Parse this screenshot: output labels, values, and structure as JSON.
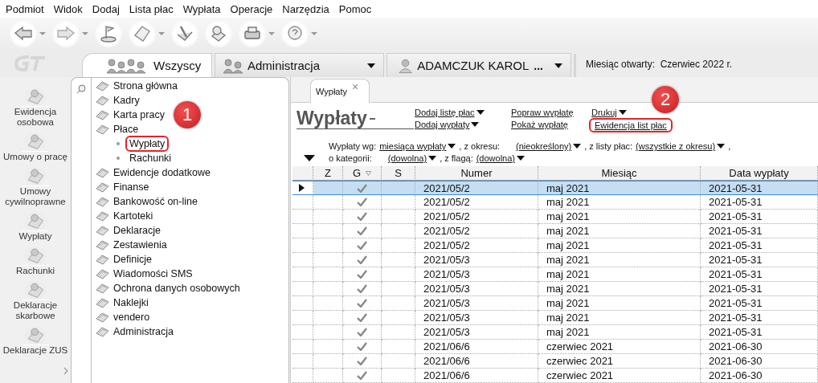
{
  "menu_bar": [
    "Podmiot",
    "Widok",
    "Dodaj",
    "Lista płac",
    "Wypłata",
    "Operacje",
    "Narzędzia",
    "Pomoc"
  ],
  "toolbar": [
    {
      "kind": "back",
      "has_menu": true
    },
    {
      "kind": "forward",
      "has_menu": true
    },
    {
      "kind": "flag",
      "has_menu": false
    },
    {
      "kind": "page",
      "has_menu": true
    },
    {
      "kind": "pen",
      "has_menu": false
    },
    {
      "kind": "magnifier",
      "has_menu": false
    },
    {
      "kind": "printer",
      "has_menu": true
    },
    {
      "kind": "help",
      "has_menu": true
    }
  ],
  "context_tabs": [
    {
      "label": "Wszyscy",
      "kind": "group",
      "selected": true,
      "has_menu": false
    },
    {
      "label": "Administracja",
      "kind": "group",
      "selected": false,
      "has_menu": true
    },
    {
      "label": "ADAMCZUK KAROL",
      "kind": "person",
      "selected": false,
      "has_menu": true,
      "more": "..."
    }
  ],
  "open_month": {
    "label": "Miesiąc otwarty:",
    "value": "Czerwiec 2022 r."
  },
  "nav": [
    "Ewidencja osobowa",
    "Umowy o pracę",
    "Umowy cywilnoprawne",
    "Wypłaty",
    "Rachunki",
    "Deklaracje skarbowe",
    "Deklaracje ZUS"
  ],
  "tree": [
    {
      "label": "Strona główna"
    },
    {
      "label": "Kadry"
    },
    {
      "label": "Karta pracy"
    },
    {
      "label": "Płace",
      "children": [
        {
          "label": "Wypłaty",
          "callout": "1"
        },
        {
          "label": "Rachunki"
        }
      ]
    },
    {
      "label": "Ewidencje dodatkowe"
    },
    {
      "label": "Finanse"
    },
    {
      "label": "Bankowość on-line"
    },
    {
      "label": "Kartoteki"
    },
    {
      "label": "Deklaracje"
    },
    {
      "label": "Zestawienia"
    },
    {
      "label": "Definicje"
    },
    {
      "label": "Wiadomości SMS"
    },
    {
      "label": "Ochrona danych osobowych"
    },
    {
      "label": "Naklejki"
    },
    {
      "label": "vendero"
    },
    {
      "label": "Administracja"
    }
  ],
  "document_tab": {
    "label": "Wypłaty",
    "close": "×"
  },
  "page_title": "Wypłaty",
  "actions": [
    [
      {
        "label": "Dodaj listę płac",
        "has_menu": true
      },
      {
        "label": "Dodaj wypłaty",
        "has_menu": true
      }
    ],
    [
      {
        "label": "Popraw wypłatę",
        "has_menu": false
      },
      {
        "label": "Pokaż wypłatę",
        "has_menu": false
      }
    ],
    [
      {
        "label": "Drukuj",
        "has_menu": true
      },
      {
        "label": "Ewidencja list płac",
        "has_menu": false,
        "callout": "2"
      }
    ]
  ],
  "filters": [
    [
      {
        "kind": "text",
        "text": "Wypłaty wg:"
      },
      {
        "kind": "dropdown",
        "text": "miesiąca wypłaty"
      },
      {
        "kind": "text",
        "text": ", z okresu:"
      },
      {
        "kind": "dropdown",
        "text": "(nieokreślony)"
      },
      {
        "kind": "text",
        "text": ", z listy płac:"
      },
      {
        "kind": "dropdown",
        "text": "(wszystkie z okresu)"
      },
      {
        "kind": "text",
        "text": ","
      }
    ],
    [
      {
        "kind": "text",
        "text": "o kategorii:"
      },
      {
        "kind": "dropdown",
        "text": "(dowolna)"
      },
      {
        "kind": "text",
        "text": ", z flagą:"
      },
      {
        "kind": "dropdown",
        "text": "(dowolna)"
      }
    ]
  ],
  "table": {
    "columns": [
      {
        "label": "Z",
        "filter": false
      },
      {
        "label": "G",
        "filter": true
      },
      {
        "label": "S",
        "filter": false
      },
      {
        "label": "Numer",
        "filter": false
      },
      {
        "label": "Miesiąc",
        "filter": false
      },
      {
        "label": "Data wypłaty",
        "filter": false
      }
    ],
    "rows": [
      {
        "selected": true,
        "checked": true,
        "number": "2021/05/2",
        "month": "maj 2021",
        "date": "2021-05-31"
      },
      {
        "selected": false,
        "checked": true,
        "number": "2021/05/2",
        "month": "maj 2021",
        "date": "2021-05-31"
      },
      {
        "selected": false,
        "checked": true,
        "number": "2021/05/2",
        "month": "maj 2021",
        "date": "2021-05-31"
      },
      {
        "selected": false,
        "checked": true,
        "number": "2021/05/2",
        "month": "maj 2021",
        "date": "2021-05-31"
      },
      {
        "selected": false,
        "checked": true,
        "number": "2021/05/2",
        "month": "maj 2021",
        "date": "2021-05-31"
      },
      {
        "selected": false,
        "checked": true,
        "number": "2021/05/3",
        "month": "maj 2021",
        "date": "2021-05-31"
      },
      {
        "selected": false,
        "checked": true,
        "number": "2021/05/3",
        "month": "maj 2021",
        "date": "2021-05-31"
      },
      {
        "selected": false,
        "checked": true,
        "number": "2021/05/3",
        "month": "maj 2021",
        "date": "2021-05-31"
      },
      {
        "selected": false,
        "checked": true,
        "number": "2021/05/3",
        "month": "maj 2021",
        "date": "2021-05-31"
      },
      {
        "selected": false,
        "checked": true,
        "number": "2021/05/3",
        "month": "maj 2021",
        "date": "2021-05-31"
      },
      {
        "selected": false,
        "checked": true,
        "number": "2021/05/3",
        "month": "maj 2021",
        "date": "2021-05-31"
      },
      {
        "selected": false,
        "checked": true,
        "number": "2021/06/6",
        "month": "czerwiec 2021",
        "date": "2021-06-30"
      },
      {
        "selected": false,
        "checked": true,
        "number": "2021/06/6",
        "month": "czerwiec 2021",
        "date": "2021-06-30"
      },
      {
        "selected": false,
        "checked": true,
        "number": "2021/06/6",
        "month": "czerwiec 2021",
        "date": "2021-06-30"
      }
    ]
  }
}
